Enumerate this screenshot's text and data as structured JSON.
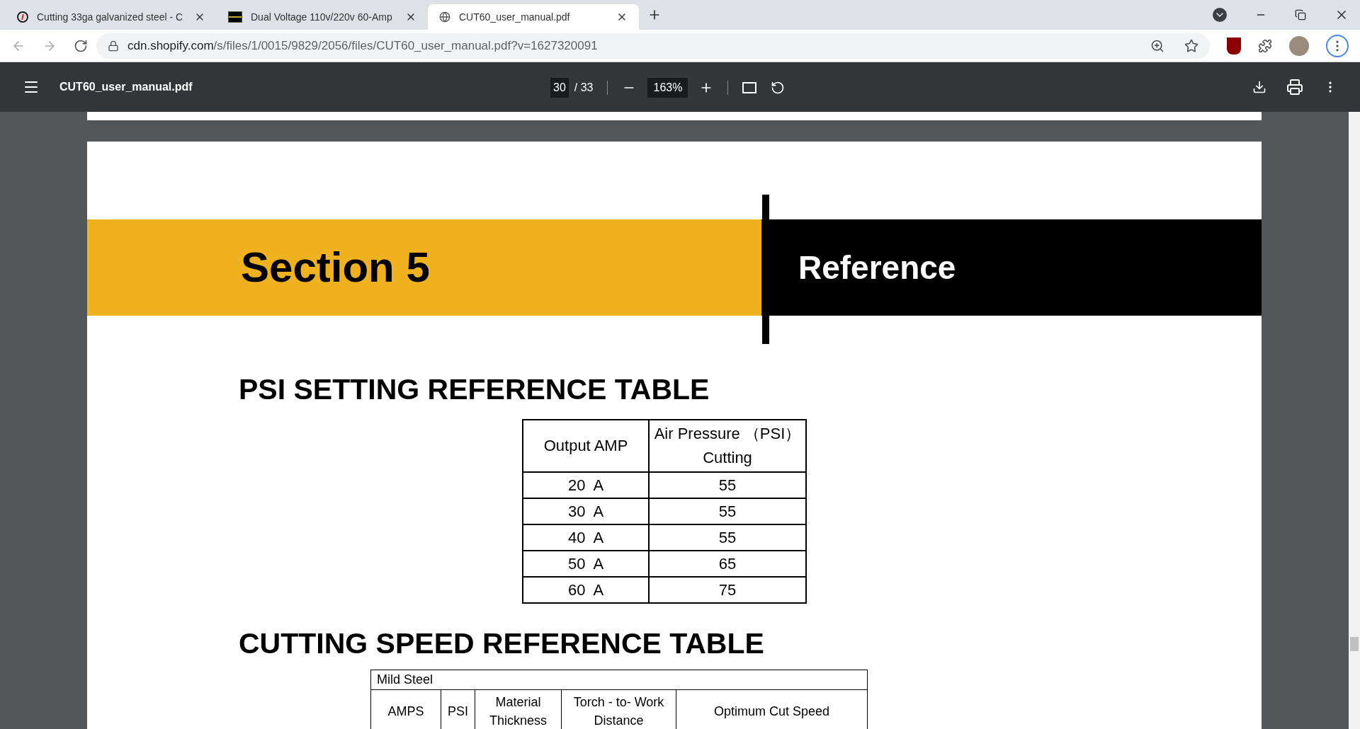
{
  "tabs": [
    {
      "title": "Cutting 33ga galvanized steel - C",
      "selected": false
    },
    {
      "title": "Dual Voltage 110v/220v 60-Amp",
      "selected": false
    },
    {
      "title": "CUT60_user_manual.pdf",
      "selected": true
    }
  ],
  "address": {
    "host": "cdn.shopify.com",
    "path": "/s/files/1/0015/9829/2056/files/CUT60_user_manual.pdf?v=1627320091"
  },
  "pdf_toolbar": {
    "title": "CUT60_user_manual.pdf",
    "page": "30",
    "total": "/ 33",
    "zoom": "163%"
  },
  "banner": {
    "section": "Section 5",
    "title": "Reference"
  },
  "psi_table": {
    "heading": "PSI SETTING REFERENCE TABLE",
    "columns": [
      "Output AMP",
      "Air Pressure （PSI）\nCutting"
    ],
    "rows": [
      [
        "20  A",
        "55"
      ],
      [
        "30  A",
        "55"
      ],
      [
        "40  A",
        "55"
      ],
      [
        "50  A",
        "65"
      ],
      [
        "60  A",
        "75"
      ]
    ]
  },
  "speed_table": {
    "heading": "CUTTING SPEED REFERENCE TABLE",
    "group": "Mild Steel",
    "columns": [
      "AMPS",
      "PSI",
      "Material\nThickness",
      "Torch - to- Work\nDistance",
      "Optimum Cut Speed"
    ]
  }
}
